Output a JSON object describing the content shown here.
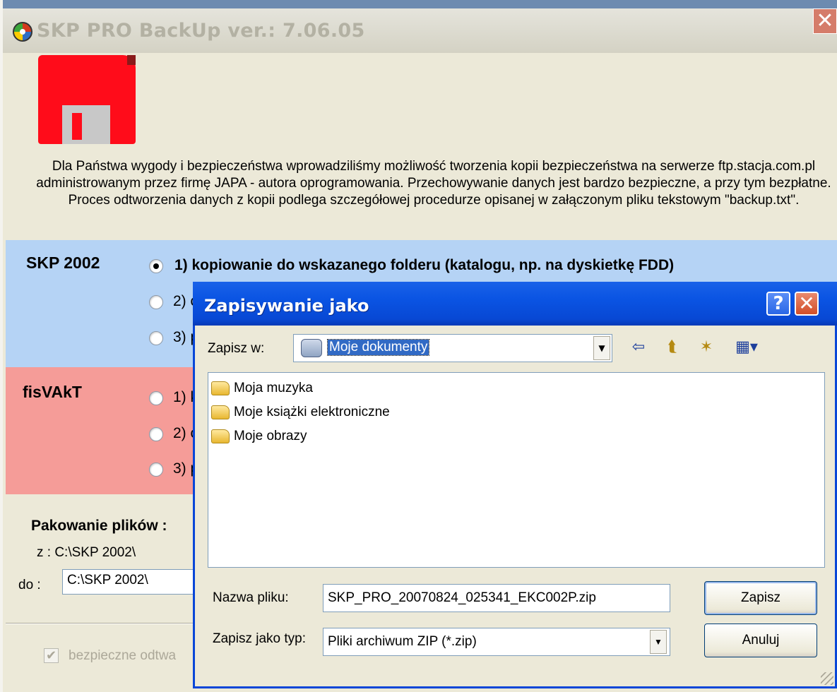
{
  "main_window": {
    "title": "SKP PRO BackUp  ver.: 7.06.05",
    "close_label": "✕",
    "intro_text": "Dla Państwa wygody i bezpieczeństwa wprowadziliśmy możliwość tworzenia kopii bezpieczeństwa na serwerze ftp.stacja.com.pl administrowanym przez firmę JAPA - autora oprogramowania. Przechowywanie danych jest bardzo bezpieczne, a przy tym bezpłatne. Proces odtworzenia danych z kopii podlega szczegółowej procedurze opisanej w załączonym pliku tekstowym \"backup.txt\".",
    "skp": {
      "label": "SKP 2002",
      "options": [
        {
          "label": "1) kopiowanie do wskazanego folderu (katalogu, np. na dyskietkę FDD)",
          "checked": true
        },
        {
          "label": "2) c",
          "checked": false
        },
        {
          "label": "3) p",
          "checked": false
        }
      ]
    },
    "fis": {
      "label": "fisVAkT",
      "options": [
        {
          "label": "1) k",
          "checked": false
        },
        {
          "label": "2) c",
          "checked": false
        },
        {
          "label": "3) p",
          "checked": false
        }
      ]
    },
    "packing": {
      "title": "Pakowanie plików :",
      "from_text": "z :  C:\\SKP 2002\\",
      "to_label": "do :",
      "to_value": "C:\\SKP 2002\\"
    },
    "safe_restore": {
      "label": "bezpieczne odtwa",
      "checked": true
    }
  },
  "save_dialog": {
    "title": "Zapisywanie jako",
    "help_label": "?",
    "close_label": "✕",
    "save_in_label": "Zapisz w:",
    "save_in_value": "Moje dokumenty",
    "files": [
      {
        "name": "Moja muzyka",
        "icon": "music-folder-icon"
      },
      {
        "name": "Moje książki elektroniczne",
        "icon": "folder-icon"
      },
      {
        "name": "Moje obrazy",
        "icon": "pictures-folder-icon"
      }
    ],
    "filename_label": "Nazwa pliku:",
    "filename_value": "SKP_PRO_20070824_025341_EKC002P.zip",
    "filetype_label": "Zapisz jako typ:",
    "filetype_value": "Pliki archiwum ZIP (*.zip)",
    "save_button": "Zapisz",
    "cancel_button": "Anuluj"
  },
  "colors": {
    "skp_section": "#b5d3f5",
    "fis_section": "#f59c98",
    "dialog_titlebar": "#0a54e3",
    "floppy": "#ff0c1a"
  }
}
